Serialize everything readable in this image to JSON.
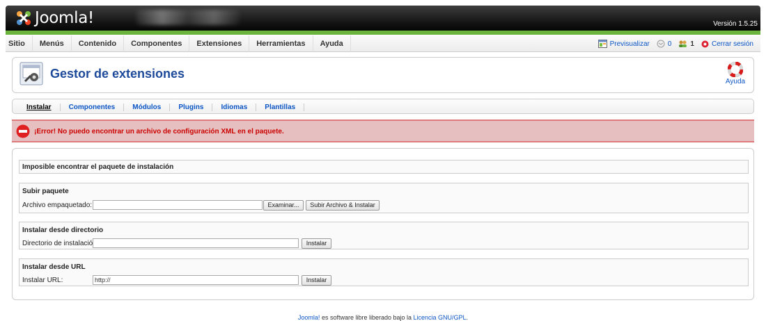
{
  "header": {
    "logo_text": "Joomla!",
    "version": "Versión 1.5.25",
    "colors": {
      "header_bg": "#000000",
      "accent_green": "#6ab43e"
    }
  },
  "menu": {
    "items": [
      "Sitio",
      "Menús",
      "Contenido",
      "Componentes",
      "Extensiones",
      "Herramientas",
      "Ayuda"
    ]
  },
  "status": {
    "preview": "Previsualizar",
    "messages_count": "0",
    "users_count": "1",
    "logout": "Cerrar sesión"
  },
  "toolbar": {
    "title": "Gestor de extensiones",
    "help_label": "Ayuda"
  },
  "submenu": {
    "items": [
      {
        "label": "Instalar",
        "active": true
      },
      {
        "label": "Componentes",
        "active": false
      },
      {
        "label": "Módulos",
        "active": false
      },
      {
        "label": "Plugins",
        "active": false
      },
      {
        "label": "Idiomas",
        "active": false
      },
      {
        "label": "Plantillas",
        "active": false
      }
    ]
  },
  "error": {
    "message": "¡Error! No puedo encontrar un archivo de configuración XML en el paquete.",
    "color": "#cc0000"
  },
  "content": {
    "notice_title": "Imposible encontrar el paquete de instalación",
    "upload": {
      "title": "Subir paquete",
      "label": "Archivo empaquetado:",
      "value": "",
      "browse": "Examinar...",
      "submit": "Subir Archivo & Instalar"
    },
    "directory": {
      "title": "Instalar desde directorio",
      "label": "Directorio de instalación:",
      "value": "",
      "submit": "Instalar"
    },
    "url": {
      "title": "Instalar desde URL",
      "label": "Instalar URL:",
      "value": "http://",
      "submit": "Instalar"
    }
  },
  "footer": {
    "link1": "Joomla!",
    "text": " es software libre liberado bajo la ",
    "link2": "Licencia GNU/GPL",
    "end": "."
  }
}
